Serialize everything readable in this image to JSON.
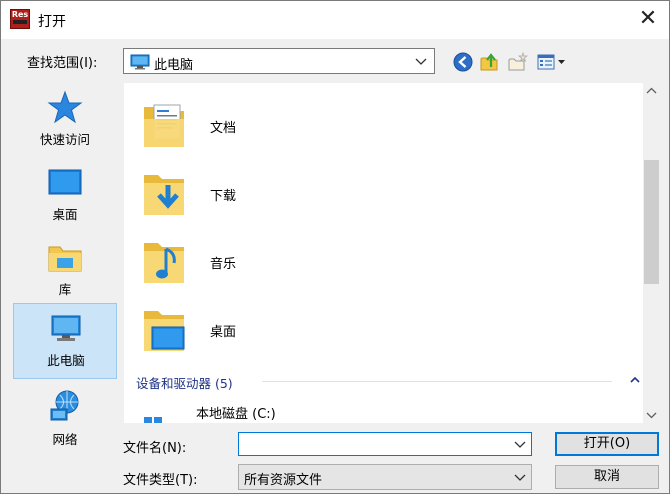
{
  "window": {
    "title": "打开",
    "close_glyph": "✕",
    "app_icon_text": "Res"
  },
  "location": {
    "label": "查找范围(I):",
    "value": "此电脑"
  },
  "toolbar": {
    "back_icon": "back-arrow-icon",
    "up_icon": "up-folder-icon",
    "new_folder_icon": "new-folder-icon",
    "view_menu_icon": "view-menu-icon"
  },
  "places": [
    {
      "label": "快速访问",
      "icon": "quick-access-star-icon"
    },
    {
      "label": "桌面",
      "icon": "desktop-icon"
    },
    {
      "label": "库",
      "icon": "library-icon"
    },
    {
      "label": "此电脑",
      "icon": "this-pc-icon",
      "selected": true
    },
    {
      "label": "网络",
      "icon": "network-icon"
    }
  ],
  "list": {
    "folders": [
      {
        "label": "文档",
        "icon": "documents-folder-icon"
      },
      {
        "label": "下载",
        "icon": "downloads-folder-icon"
      },
      {
        "label": "音乐",
        "icon": "music-folder-icon"
      },
      {
        "label": "桌面",
        "icon": "desktop-folder-icon"
      }
    ],
    "group": {
      "title": "设备和驱动器 (5)"
    },
    "drives": [
      {
        "label": "本地磁盘 (C:)",
        "icon": "windows-drive-icon"
      }
    ]
  },
  "filename": {
    "label": "文件名(N):",
    "value": ""
  },
  "filetype": {
    "label": "文件类型(T):",
    "value": "所有资源文件"
  },
  "buttons": {
    "open": "打开(O)",
    "cancel": "取消"
  },
  "colors": {
    "accent": "#0078d7",
    "selection": "#cce4f7",
    "group_header": "#1e3287",
    "folder_yellow": "#f8d775"
  }
}
